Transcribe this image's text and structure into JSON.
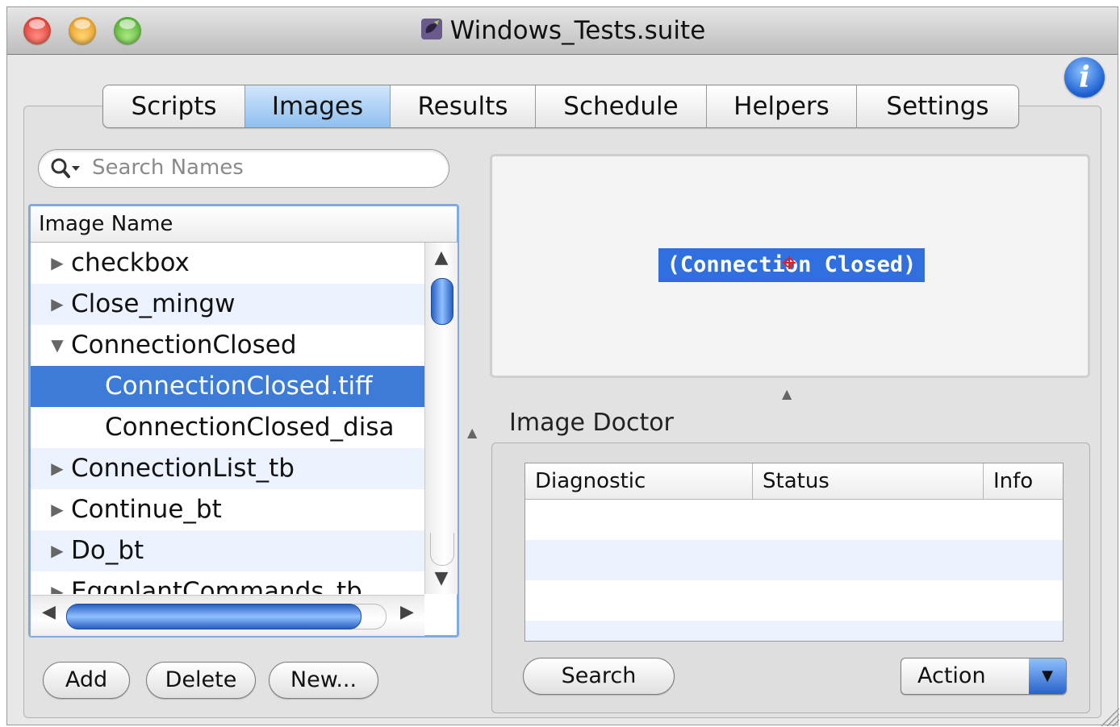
{
  "window": {
    "title": "Windows_Tests.suite",
    "icons": {
      "suite": "eggplant-suite-icon",
      "info": "info-icon"
    },
    "info_glyph": "i"
  },
  "tabs": [
    {
      "label": "Scripts",
      "selected": false
    },
    {
      "label": "Images",
      "selected": true
    },
    {
      "label": "Results",
      "selected": false
    },
    {
      "label": "Schedule",
      "selected": false
    },
    {
      "label": "Helpers",
      "selected": false
    },
    {
      "label": "Settings",
      "selected": false
    }
  ],
  "search": {
    "placeholder": "Search Names",
    "value": ""
  },
  "image_list": {
    "header": "Image Name",
    "rows": [
      {
        "label": "checkbox",
        "type": "group",
        "expanded": false,
        "selected": false
      },
      {
        "label": "Close_mingw",
        "type": "group",
        "expanded": false,
        "selected": false
      },
      {
        "label": "ConnectionClosed",
        "type": "group",
        "expanded": true,
        "selected": false
      },
      {
        "label": "ConnectionClosed.tiff",
        "type": "child",
        "selected": true
      },
      {
        "label": "ConnectionClosed_disa",
        "type": "child",
        "selected": false
      },
      {
        "label": "ConnectionList_tb",
        "type": "group",
        "expanded": false,
        "selected": false
      },
      {
        "label": "Continue_bt",
        "type": "group",
        "expanded": false,
        "selected": false
      },
      {
        "label": "Do_bt",
        "type": "group",
        "expanded": false,
        "selected": false
      },
      {
        "label": "EggplantCommands_tb",
        "type": "group",
        "expanded": false,
        "selected": false
      }
    ],
    "vertical_scroll_position": 0.1,
    "horizontal_scroll_position": 0.0
  },
  "list_buttons": {
    "add": "Add",
    "delete": "Delete",
    "new": "New..."
  },
  "preview": {
    "image_text": "(Connection Closed)",
    "highlight_color": "#2f6fe0",
    "hotspot_color": "#e02020"
  },
  "image_doctor": {
    "title": "Image Doctor",
    "columns": [
      "Diagnostic",
      "Status",
      "Info"
    ],
    "rows": [],
    "search_button": "Search",
    "action_popup": "Action"
  },
  "colors": {
    "selection": "#3d7bd9",
    "accent_blue": "#2a63c9",
    "alt_row": "#edf3fe"
  }
}
